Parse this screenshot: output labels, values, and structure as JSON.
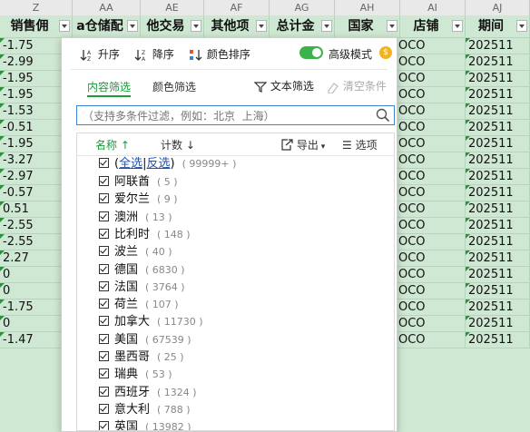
{
  "column_letters": [
    "Z",
    "AA",
    "AE",
    "AF",
    "AG",
    "AH",
    "AI",
    "AJ"
  ],
  "headers": [
    "销售佣",
    "a仓储配",
    "他交易",
    "其他项",
    "总计金",
    "国家",
    "店铺",
    "期间"
  ],
  "left_values": [
    "-1.75",
    "-2.99",
    "-1.95",
    "-1.95",
    "-1.53",
    "-0.51",
    "-1.95",
    "-3.27",
    "-2.97",
    "-0.57",
    "0.51",
    "-2.55",
    "-2.55",
    "2.27",
    "0",
    "0",
    "-1.75",
    "0",
    "-1.47"
  ],
  "shop_values": [
    "OCO",
    "OCO",
    "OCO",
    "OCO",
    "OCO",
    "OCO",
    "OCO",
    "OCO",
    "OCO",
    "OCO",
    "OCO",
    "OCO",
    "OCO",
    "OCO",
    "OCO",
    "OCO",
    "OCO",
    "OCO",
    "OCO"
  ],
  "period_values": [
    "202511",
    "202511",
    "202511",
    "202511",
    "202511",
    "202511",
    "202511",
    "202511",
    "202511",
    "202511",
    "202511",
    "202511",
    "202511",
    "202511",
    "202511",
    "202511",
    "202511",
    "202511",
    "202511"
  ],
  "panel": {
    "sort_asc": "升序",
    "sort_desc": "降序",
    "sort_color": "颜色排序",
    "advanced_mode": "高级模式",
    "tab_content": "内容筛选",
    "tab_color": "颜色筛选",
    "text_filter": "文本筛选",
    "clear": "清空条件",
    "search_placeholder": "（支持多条件过滤，例如：北京  上海）",
    "col_name": "名称",
    "col_count": "计数",
    "export": "导出",
    "options": "选项",
    "select_all": "全选",
    "invert": "反选",
    "all_count": "( 99999+ )",
    "items": [
      {
        "name": "阿联酋",
        "count": "( 5 )"
      },
      {
        "name": "爱尔兰",
        "count": "( 9 )"
      },
      {
        "name": "澳洲",
        "count": "( 13 )"
      },
      {
        "name": "比利时",
        "count": "( 148 )"
      },
      {
        "name": "波兰",
        "count": "( 40 )"
      },
      {
        "name": "德国",
        "count": "( 6830 )"
      },
      {
        "name": "法国",
        "count": "( 3764 )"
      },
      {
        "name": "荷兰",
        "count": "( 107 )"
      },
      {
        "name": "加拿大",
        "count": "( 11730 )"
      },
      {
        "name": "美国",
        "count": "( 67539 )"
      },
      {
        "name": "墨西哥",
        "count": "( 25 )"
      },
      {
        "name": "瑞典",
        "count": "( 53 )"
      },
      {
        "name": "西班牙",
        "count": "( 1324 )"
      },
      {
        "name": "意大利",
        "count": "( 788 )"
      },
      {
        "name": "英国",
        "count": "( 13982 )"
      }
    ]
  },
  "colors": {
    "accent": "#1a9a3a",
    "cell_bg": "#cfe8d3",
    "link": "#1e4fb5"
  }
}
